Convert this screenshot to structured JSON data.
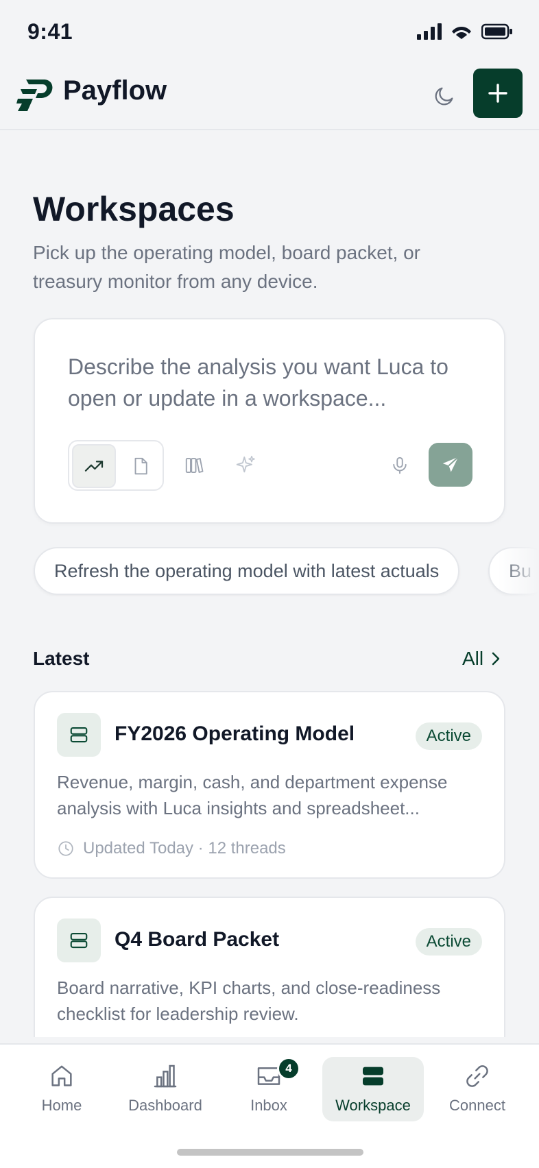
{
  "status_bar": {
    "time": "9:41"
  },
  "header": {
    "app_name": "Payflow"
  },
  "page": {
    "title": "Workspaces",
    "subtitle": "Pick up the operating model, board packet, or treasury monitor from any device."
  },
  "composer": {
    "placeholder": "Describe the analysis you want Luca to open or update in a workspace..."
  },
  "suggestions": [
    "Refresh the operating model with latest actuals",
    "Bu"
  ],
  "latest": {
    "title": "Latest",
    "all_label": "All"
  },
  "workspaces": [
    {
      "title": "FY2026 Operating Model",
      "status": "Active",
      "description": "Revenue, margin, cash, and department expense analysis with Luca insights and spreadsheet...",
      "meta": "Updated Today · 12 threads"
    },
    {
      "title": "Q4 Board Packet",
      "status": "Active",
      "description": "Board narrative, KPI charts, and close-readiness checklist for leadership review."
    }
  ],
  "nav": {
    "items": [
      {
        "label": "Home",
        "icon": "home-icon"
      },
      {
        "label": "Dashboard",
        "icon": "bar-chart-icon"
      },
      {
        "label": "Inbox",
        "icon": "inbox-icon",
        "badge": "4"
      },
      {
        "label": "Workspace",
        "icon": "workspace-icon"
      },
      {
        "label": "Connect",
        "icon": "link-icon"
      }
    ],
    "active": "Workspace"
  },
  "colors": {
    "brand": "#063d2b",
    "badge_bg": "#e7eeea",
    "send_button": "#85a396",
    "page_bg": "#f3f4f6"
  }
}
